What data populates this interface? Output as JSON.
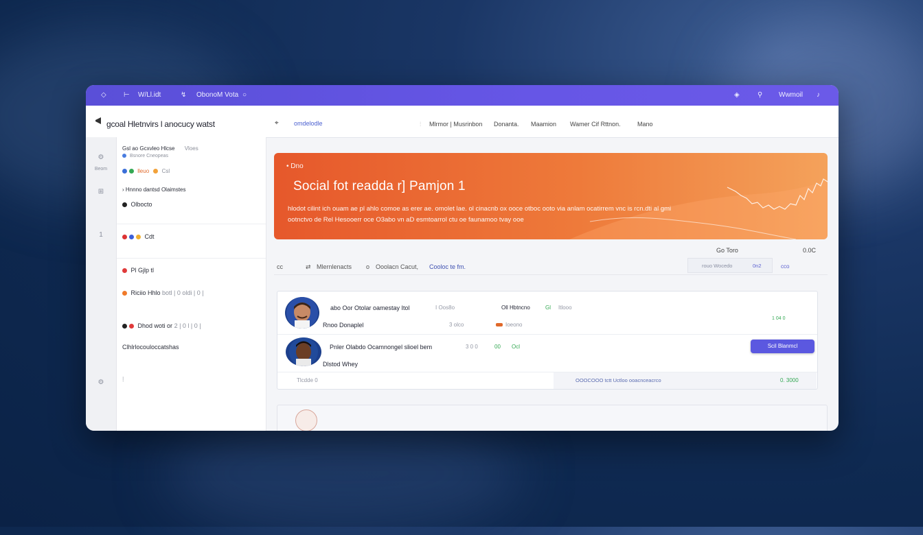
{
  "topbar": {
    "items": [
      "W/Ll.idt",
      "ObonoM Vota"
    ],
    "user": "Wwmoil"
  },
  "header": {
    "title": "gcoal Hletnvirs l anocucy watst",
    "nav_link": "omdelodle",
    "menu": [
      "Mlrmor | Musrinbon",
      "Donanta.",
      "Maamion",
      "Wamer Cif Rttnon.",
      "Mano"
    ]
  },
  "sidebar": {
    "heading": "Gsl ao Gcxvleo Hlcse",
    "heading_side": "Vloes",
    "sub": "Bsnore Cneopeas",
    "tags": [
      "lleuo",
      "Csl"
    ],
    "section": "Hnnno dantsd Olaimstes",
    "items": [
      {
        "label": "Olbocto",
        "extra": ""
      },
      {
        "label": "Cdt",
        "extra": ""
      },
      {
        "label": "Pl Gjlp tl",
        "extra": ""
      },
      {
        "label": "Riciio Hhlo",
        "extra": "botl | 0 oldi | 0 |"
      },
      {
        "label": "Dhod woti or",
        "extra": "2 | 0 l | 0 |"
      },
      {
        "label": "Clhlrlocouloccatshas",
        "extra": ""
      }
    ],
    "rail_labels": [
      "Beom",
      "1"
    ]
  },
  "banner": {
    "tag": "Dno",
    "title": "Social fot readda r] Pamjon 1",
    "desc": "hlodot cilint ich ouam ae pl ahlo comoe as erer ae. omolet lae. ol cinacnb ox ooce otboc ooto via anlam ocatirrem vnc is rcn.dti al gmi ootnctvo de Rel Hesooerr oce O3abo vn aD esmtoarrol ctu oe faunamoo tvay ooe"
  },
  "stats": {
    "label": "Go Toro",
    "value": "0.0C"
  },
  "filterbar": {
    "count": "cc",
    "label": "Mlernlenacts",
    "sep": "o",
    "desc": "Ooolacn Cacut,",
    "link": "Cooloc te fm.",
    "box_a": "rouo Wocedo",
    "box_b": "0n2",
    "side": "cco"
  },
  "posts": [
    {
      "title": "abo Oor Otolar oamestay Itol",
      "meta_a": "I Oos8o",
      "meta_b": "Oll Hbtncno",
      "meta_green": "Gl",
      "meta_c": "Itlooo",
      "author": "Rnoo Donaplel",
      "stat_a": "3 olco",
      "stat_b": "Ioeono",
      "right": "1 04 0"
    },
    {
      "title": "Pnler Olabdo Ocamnongel slioel bem",
      "meta_a": "3 0 0",
      "meta_green": "00",
      "meta_c": "Ocl",
      "author": "Dlstod Whey",
      "button": "Scil Blanmcl"
    }
  ],
  "card_footer": {
    "left": "Tlcdde 0",
    "mid": "OOOCOOO tctt Uctloo ooacnceacrco",
    "right": "0. 3000"
  }
}
